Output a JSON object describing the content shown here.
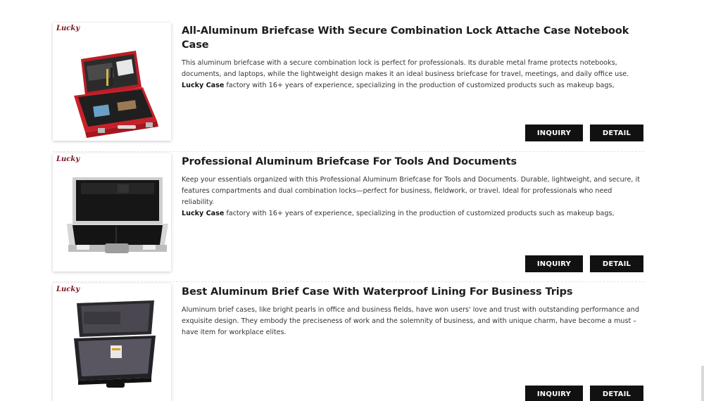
{
  "products": [
    {
      "brand": "Lucky",
      "title": "All-Aluminum Briefcase With Secure Combination Lock Attache Case Notebook Case",
      "desc_main": "This aluminum briefcase with a secure combination lock is perfect for professionals. Its durable metal frame protects notebooks, documents, and laptops, while the lightweight design makes it an ideal business briefcase for travel, meetings, and daily office use.",
      "factory_name": "Lucky Case",
      "factory_text": " factory with 16+ years of experience, specializing in the production of customized products such as makeup bags,",
      "inquiry_label": "INQUIRY",
      "detail_label": "DETAIL",
      "image_icon": "red-briefcase-image"
    },
    {
      "brand": "Lucky",
      "title": "Professional Aluminum Briefcase For Tools And Documents",
      "desc_main": "Keep your essentials organized with this Professional Aluminum Briefcase for Tools and Documents. Durable, lightweight, and secure, it features compartments and dual combination  locks—perfect for business, fieldwork, or travel. Ideal for professionals who need reliability.",
      "factory_name": "Lucky Case",
      "factory_text": " factory with 16+ years of experience, specializing in the production of customized products such as makeup bags,",
      "inquiry_label": "INQUIRY",
      "detail_label": "DETAIL",
      "image_icon": "silver-briefcase-image"
    },
    {
      "brand": "Lucky",
      "title": "Best Aluminum Brief Case With Waterproof Lining For Business Trips",
      "desc_main": "Aluminum brief cases, like bright pearls in office and business fields, have won users' love and trust with outstanding performance and exquisite design. They embody the preciseness of work and the solemnity of business, and with unique charm, have become a must – have item for workplace elites.",
      "factory_name": "",
      "factory_text": "",
      "inquiry_label": "INQUIRY",
      "detail_label": "DETAIL",
      "image_icon": "black-briefcase-image"
    }
  ],
  "colors": {
    "button_bg": "#111111",
    "button_text": "#ffffff",
    "red_case": "#c8202a",
    "brand": "#7a1420"
  }
}
